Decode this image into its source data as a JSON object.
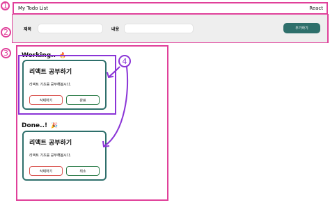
{
  "header": {
    "title": "My Todo List",
    "brand": "React"
  },
  "form": {
    "title_label": "제목",
    "content_label": "내용",
    "title_value": "",
    "content_value": "",
    "add_label": "추가하기"
  },
  "working": {
    "title": "Working..",
    "emoji": "🔥",
    "items": [
      {
        "title": "리액트 공부하기",
        "body": "리액트 기초를 공부해봅시다.",
        "delete_label": "삭제하기",
        "toggle_label": "완료"
      }
    ]
  },
  "done": {
    "title": "Done..!",
    "emoji": "🎉",
    "items": [
      {
        "title": "리액트 공부하기",
        "body": "리액트 기초를 공부해봅시다.",
        "delete_label": "삭제하기",
        "toggle_label": "취소"
      }
    ]
  },
  "annotations": {
    "one": "1",
    "two": "2",
    "three": "3",
    "four": "4"
  },
  "colors": {
    "accent": "#2e6f6b",
    "annotation_pink": "#e0409a",
    "annotation_purple": "#8a34d6",
    "delete_border": "#d9534f",
    "toggle_border": "#2e7d4a"
  }
}
